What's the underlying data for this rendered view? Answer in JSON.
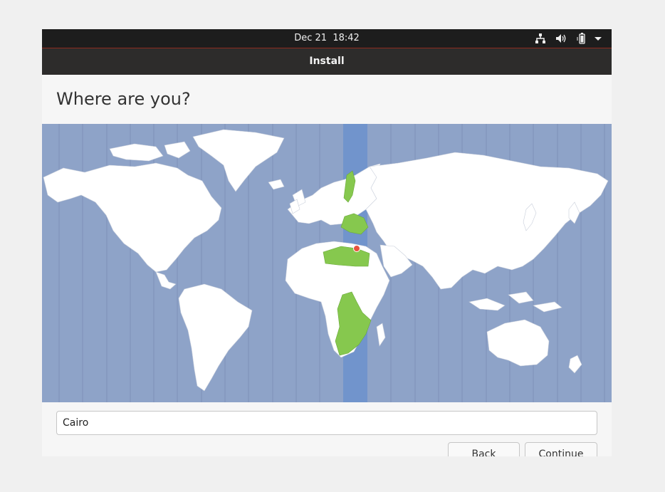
{
  "system_bar": {
    "clock": "Dec 21  18:42",
    "icons": [
      "network-icon",
      "volume-icon",
      "battery-icon",
      "system-menu-chevron-icon"
    ]
  },
  "window": {
    "title": "Install"
  },
  "page": {
    "heading": "Where are you?"
  },
  "map": {
    "ocean_color": "#8ea3c8",
    "land_color": "#ffffff",
    "highlight_zone_color": "#7194cc",
    "highlight_country_color": "#86c84e",
    "pin_color": "#e8533f"
  },
  "location": {
    "value": "Cairo"
  },
  "buttons": {
    "back": "Back",
    "continue": "Continue"
  },
  "colors": {
    "top_bar": "#1d1d1d",
    "title_bar": "#2d2c2b",
    "accent_line": "#8e2a1e"
  }
}
